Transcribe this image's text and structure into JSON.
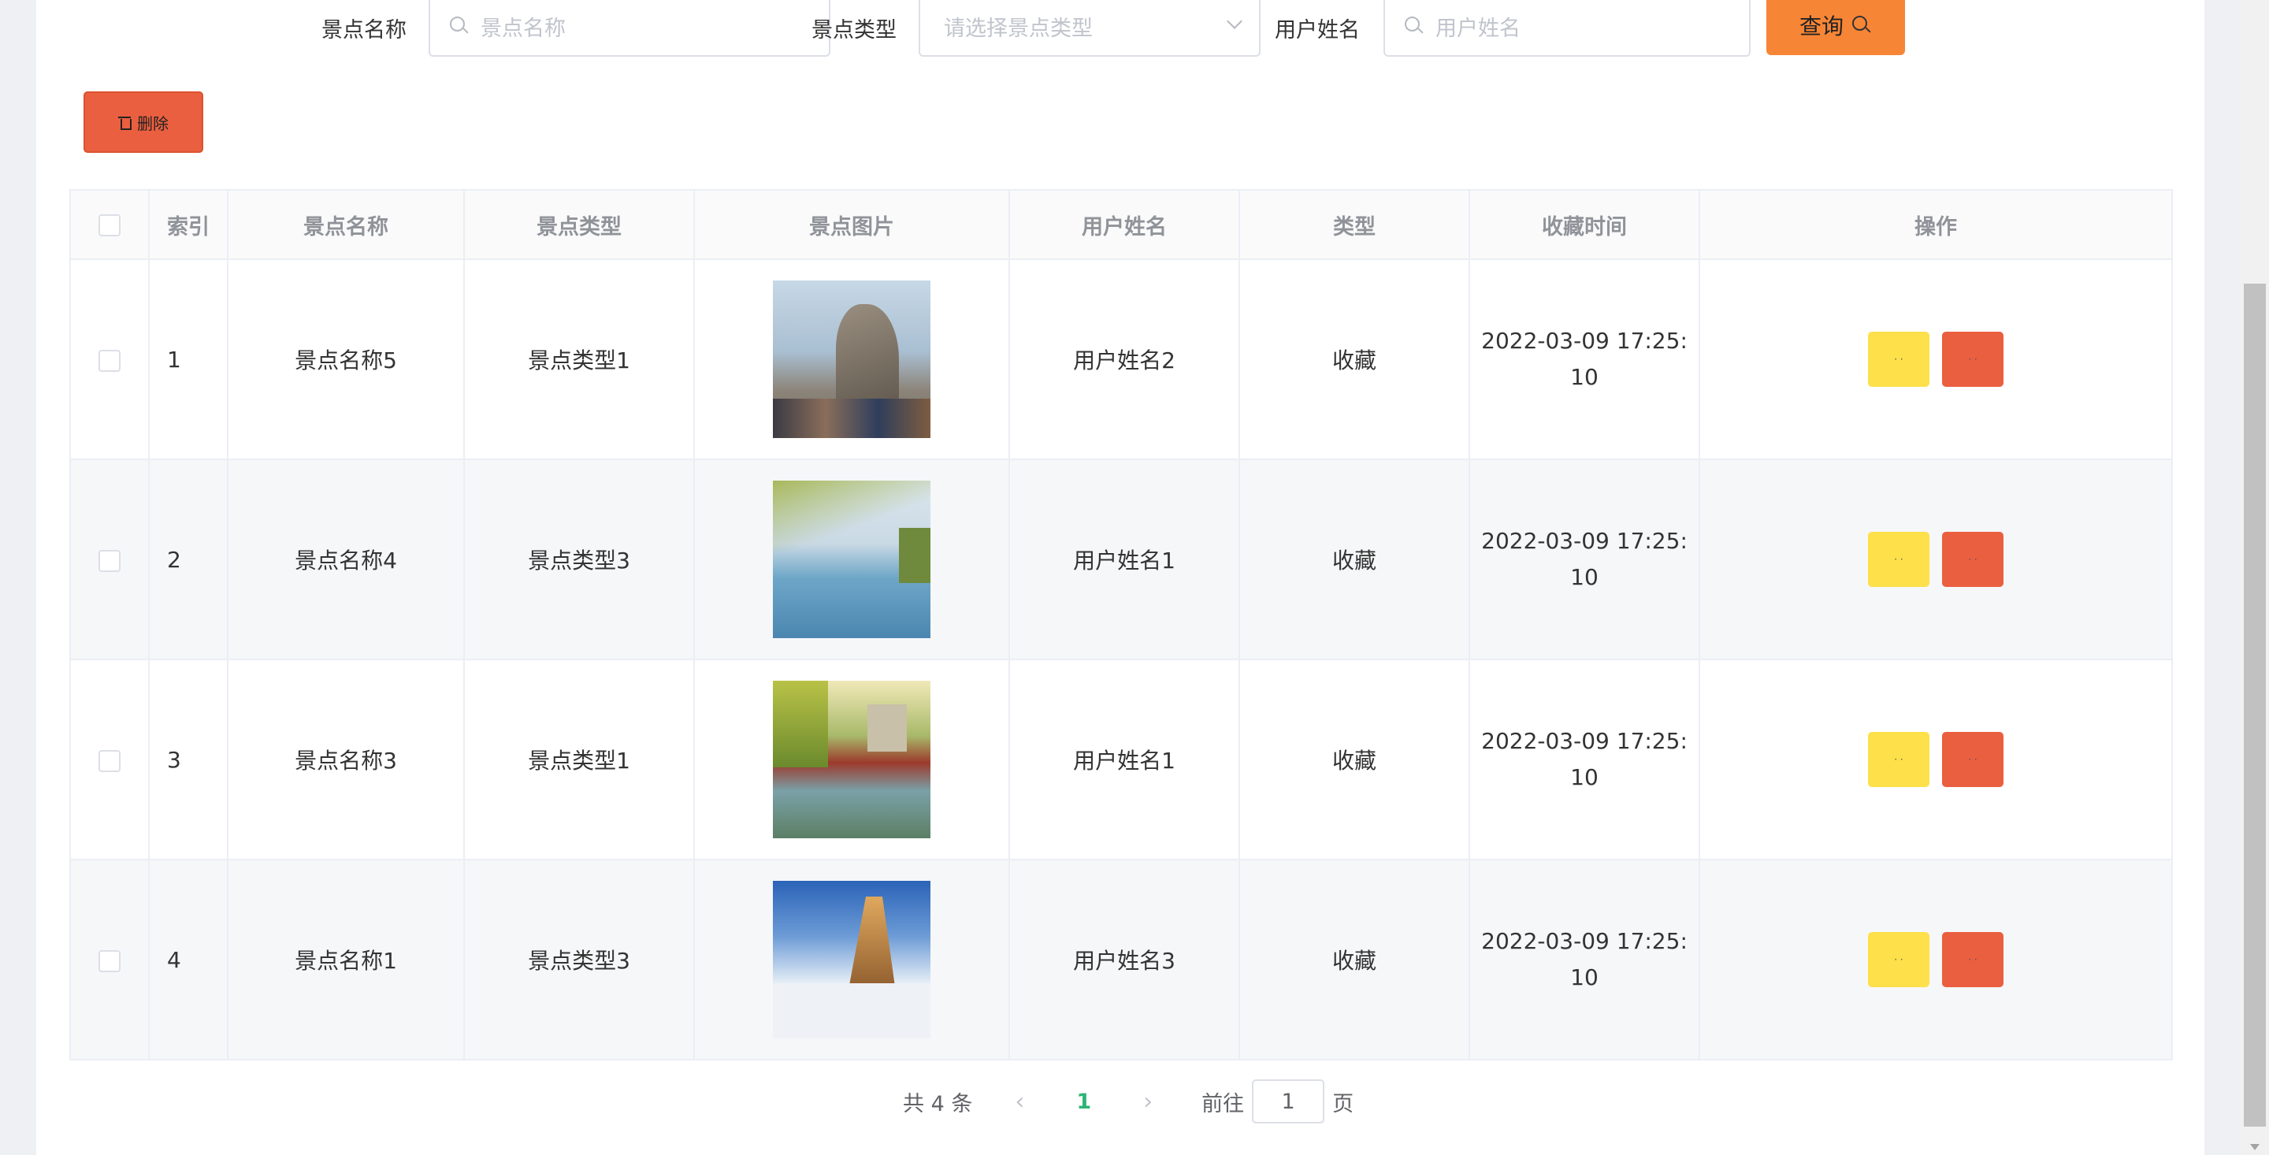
{
  "search": {
    "name_label": "景点名称",
    "name_placeholder": "景点名称",
    "type_label": "景点类型",
    "type_placeholder": "请选择景点类型",
    "user_label": "用户姓名",
    "user_placeholder": "用户姓名",
    "query_label": "查询"
  },
  "toolbar": {
    "delete_label": "删除"
  },
  "table": {
    "headers": [
      "索引",
      "景点名称",
      "景点类型",
      "景点图片",
      "用户姓名",
      "类型",
      "收藏时间",
      "操作"
    ],
    "rows": [
      {
        "index": "1",
        "name": "景点名称5",
        "type": "景点类型1",
        "image": "cliff-crowd-scene",
        "user": "用户姓名2",
        "kind": "收藏",
        "time_date": "2022-03-09 17:25:",
        "time_sec": "10"
      },
      {
        "index": "2",
        "name": "景点名称4",
        "type": "景点类型3",
        "image": "lake-willow-scene",
        "user": "用户姓名1",
        "kind": "收藏",
        "time_date": "2022-03-09 17:25:",
        "time_sec": "10"
      },
      {
        "index": "3",
        "name": "景点名称3",
        "type": "景点类型1",
        "image": "pagoda-reflection-scene",
        "user": "用户姓名1",
        "kind": "收藏",
        "time_date": "2022-03-09 17:25:",
        "time_sec": "10"
      },
      {
        "index": "4",
        "name": "景点名称1",
        "type": "景点类型3",
        "image": "mountain-sea-of-clouds-scene",
        "user": "用户姓名3",
        "kind": "收藏",
        "time_date": "2022-03-09 17:25:",
        "time_sec": "10"
      }
    ],
    "op_edit_label": "· ·",
    "op_delete_label": "· ·"
  },
  "pagination": {
    "total_text": "共 4 条",
    "current_page": "1",
    "goto_label": "前往",
    "goto_value": "1",
    "page_suffix": "页"
  },
  "colors": {
    "query_button": "#f78536",
    "delete_button": "#ea5f3f",
    "edit_button": "#fde04a",
    "active_page": "#2db574"
  }
}
